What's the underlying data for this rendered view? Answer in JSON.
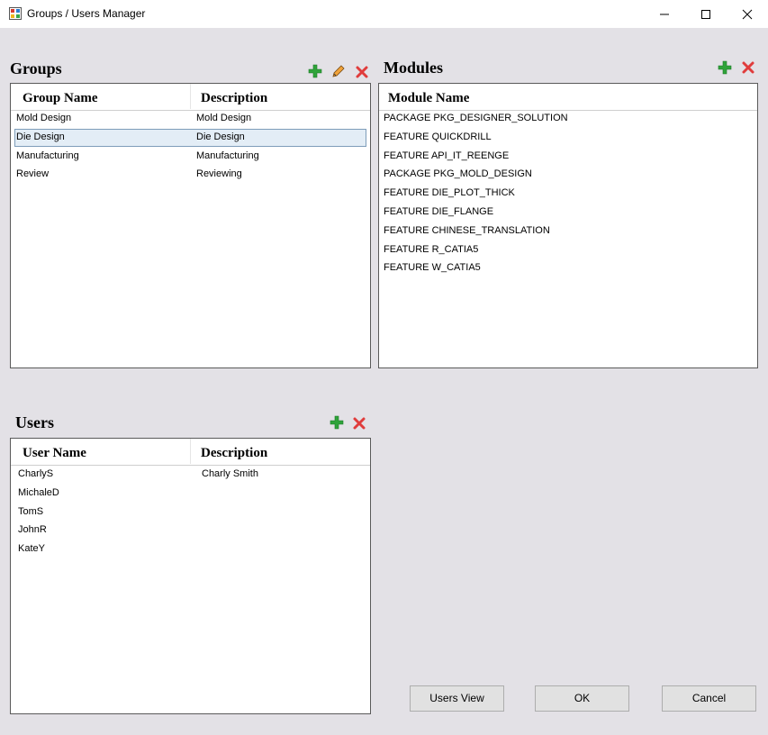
{
  "window": {
    "title": "Groups / Users Manager"
  },
  "groups": {
    "title": "Groups",
    "columns": [
      "Group Name",
      "Description"
    ],
    "rows": [
      {
        "name": "Mold Design",
        "description": "Mold Design"
      },
      {
        "name": "Die Design",
        "description": "Die Design"
      },
      {
        "name": "Manufacturing",
        "description": "Manufacturing"
      },
      {
        "name": "Review",
        "description": "Reviewing"
      }
    ],
    "selected_row": "Die Design"
  },
  "modules": {
    "title": "Modules",
    "columns": [
      "Module Name"
    ],
    "rows": [
      "PACKAGE PKG_DESIGNER_SOLUTION",
      "FEATURE QUICKDRILL",
      "FEATURE API_IT_REENGE",
      "PACKAGE PKG_MOLD_DESIGN",
      "FEATURE DIE_PLOT_THICK",
      "FEATURE DIE_FLANGE",
      "FEATURE CHINESE_TRANSLATION",
      "FEATURE R_CATIA5",
      "FEATURE W_CATIA5"
    ]
  },
  "users": {
    "title": "Users",
    "columns": [
      "User Name",
      "Description"
    ],
    "rows": [
      {
        "name": "CharlyS",
        "description": "Charly Smith"
      },
      {
        "name": "MichaleD",
        "description": ""
      },
      {
        "name": "TomS",
        "description": ""
      },
      {
        "name": "JohnR",
        "description": ""
      },
      {
        "name": "KateY",
        "description": ""
      }
    ]
  },
  "buttons": {
    "users_view": "Users View",
    "ok": "OK",
    "cancel": "Cancel"
  },
  "icons": {
    "add": "plus-icon",
    "edit": "pencil-icon",
    "delete": "x-icon"
  },
  "colors": {
    "add": "#2fa33a",
    "delete": "#e03c3c",
    "selection": "#e3edf6"
  }
}
